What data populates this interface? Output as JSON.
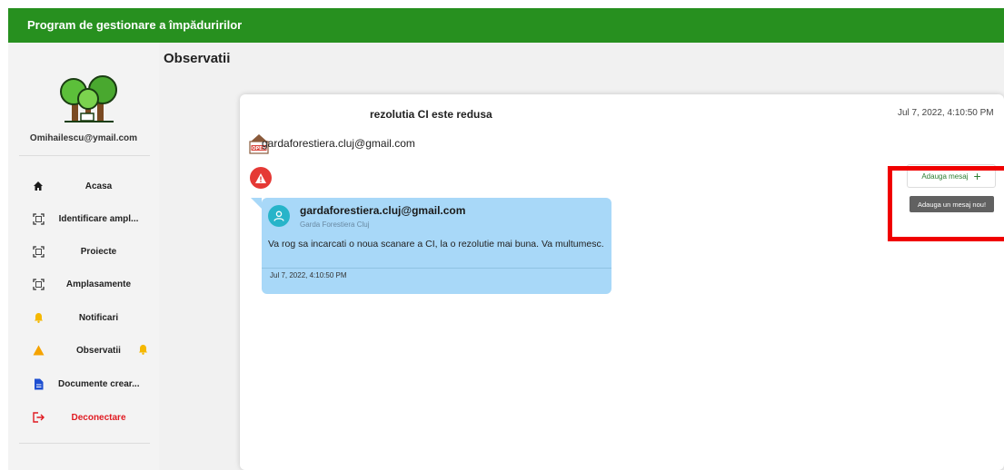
{
  "app": {
    "title": "Program de gestionare a împăduririlor"
  },
  "sidebar": {
    "user_email": "Omihailescu@ymail.com",
    "items": [
      {
        "label": "Acasa",
        "icon": "home-icon"
      },
      {
        "label": "Identificare ampl...",
        "icon": "scan-icon"
      },
      {
        "label": "Proiecte",
        "icon": "scan-icon"
      },
      {
        "label": "Amplasamente",
        "icon": "scan-icon"
      },
      {
        "label": "Notificari",
        "icon": "bell-icon"
      },
      {
        "label": "Observatii",
        "icon": "warning-icon",
        "badge": "bell-icon"
      },
      {
        "label": "Documente crear...",
        "icon": "document-icon"
      },
      {
        "label": "Deconectare",
        "icon": "logout-icon"
      }
    ]
  },
  "page": {
    "title": "Observatii"
  },
  "observation": {
    "title": "rezolutia CI este redusa",
    "date": "Jul 7, 2022, 4:10:50 PM",
    "sender_email": "gardaforestiera.cluj@gmail.com",
    "sender_icon_text": "OPEN"
  },
  "message": {
    "author": "gardaforestiera.cluj@gmail.com",
    "organization": "Garda Forestiera Cluj",
    "text": "Va rog sa incarcati o noua scanare a CI, la o rezolutie mai buna. Va multumesc.",
    "date": "Jul 7, 2022, 4:10:50 PM"
  },
  "actions": {
    "add_message_label": "Adauga mesaj",
    "add_message_tooltip": "Adauga un mesaj nou!"
  },
  "colors": {
    "topbar": "#27901f",
    "bubble": "#a8d8f8",
    "warning": "#e53935",
    "logout": "#e01b22",
    "highlight": "#f00000"
  }
}
